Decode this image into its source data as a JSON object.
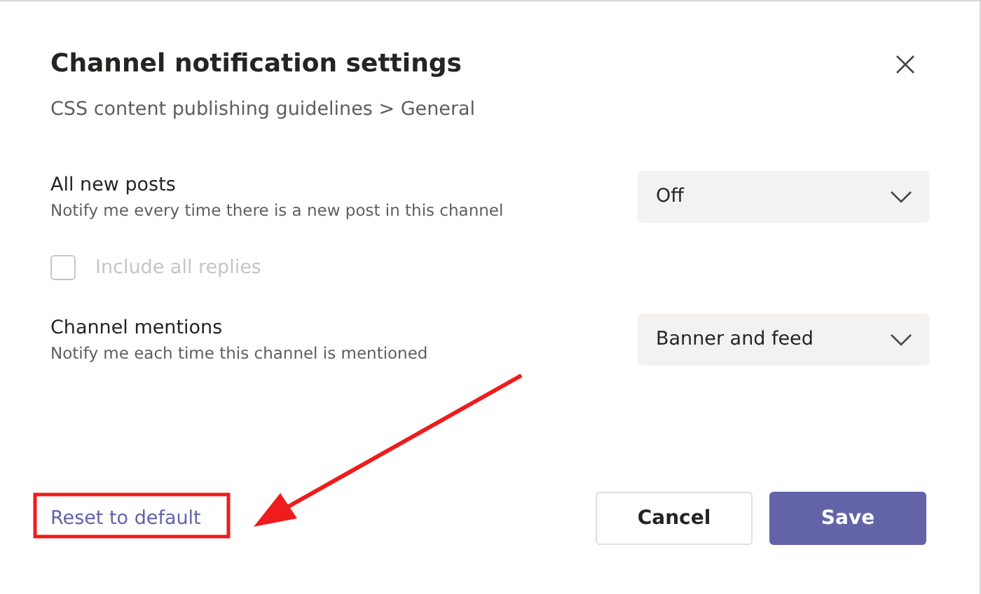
{
  "dialog": {
    "title": "Channel notification settings",
    "breadcrumb": "CSS content publishing guidelines > General"
  },
  "settings": [
    {
      "kind": "dropdown",
      "label": "All new posts",
      "description": "Notify me every time there is a new post in this channel",
      "value": "Off"
    },
    {
      "kind": "checkbox",
      "label": "Include all replies",
      "checked": false,
      "disabled": true
    },
    {
      "kind": "dropdown",
      "label": "Channel mentions",
      "description": "Notify me each time this channel is mentioned",
      "value": "Banner and feed"
    }
  ],
  "footer": {
    "link": "Reset to default",
    "buttons": [
      {
        "label": "Cancel",
        "kind": "secondary"
      },
      {
        "label": "Save",
        "kind": "primary"
      }
    ]
  }
}
